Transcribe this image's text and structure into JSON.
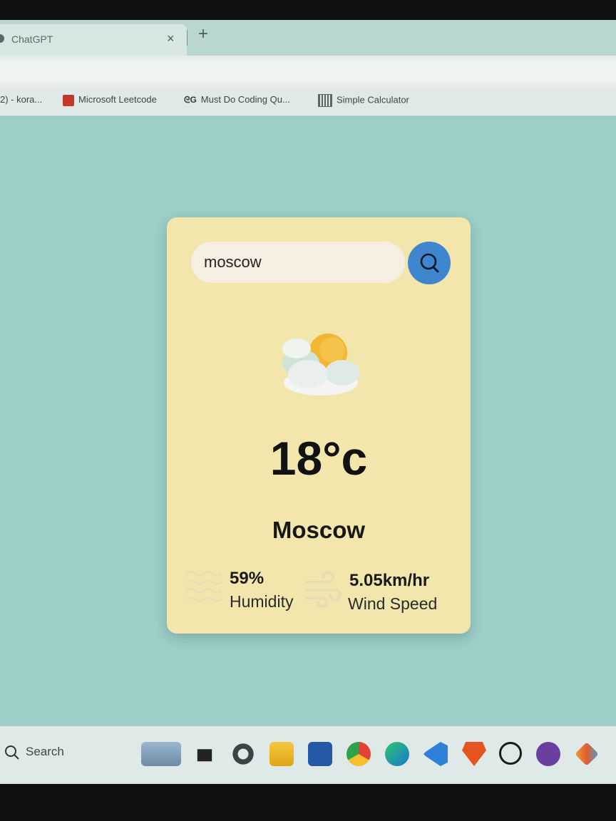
{
  "browser": {
    "tab_title": "ChatGPT",
    "tab_close": "×",
    "new_tab": "+"
  },
  "bookmarks": [
    {
      "label": "2) - kora..."
    },
    {
      "label": "Microsoft Leetcode"
    },
    {
      "label": "Must Do Coding Qu...",
      "icon": "gfg-icon"
    },
    {
      "label": "Simple Calculator"
    }
  ],
  "weather": {
    "search_value": "moscow",
    "temperature": "18°c",
    "city": "Moscow",
    "humidity_value": "59%",
    "humidity_label": "Humidity",
    "wind_value": "5.05km/hr",
    "wind_label": "Wind Speed",
    "condition_icon": "partly-cloudy-icon",
    "accent_color": "#3f86cf",
    "card_color": "#f2e6ad"
  },
  "taskbar": {
    "search_label": "Search",
    "apps": [
      "widgets-icon",
      "task-view-icon",
      "settings-icon",
      "file-explorer-icon",
      "store-icon",
      "chrome-icon",
      "edge-icon",
      "vscode-icon",
      "brave-icon",
      "whatsapp-icon",
      "github-icon",
      "git-icon"
    ]
  },
  "bookmark_gfg_glyph": "ᘓG"
}
